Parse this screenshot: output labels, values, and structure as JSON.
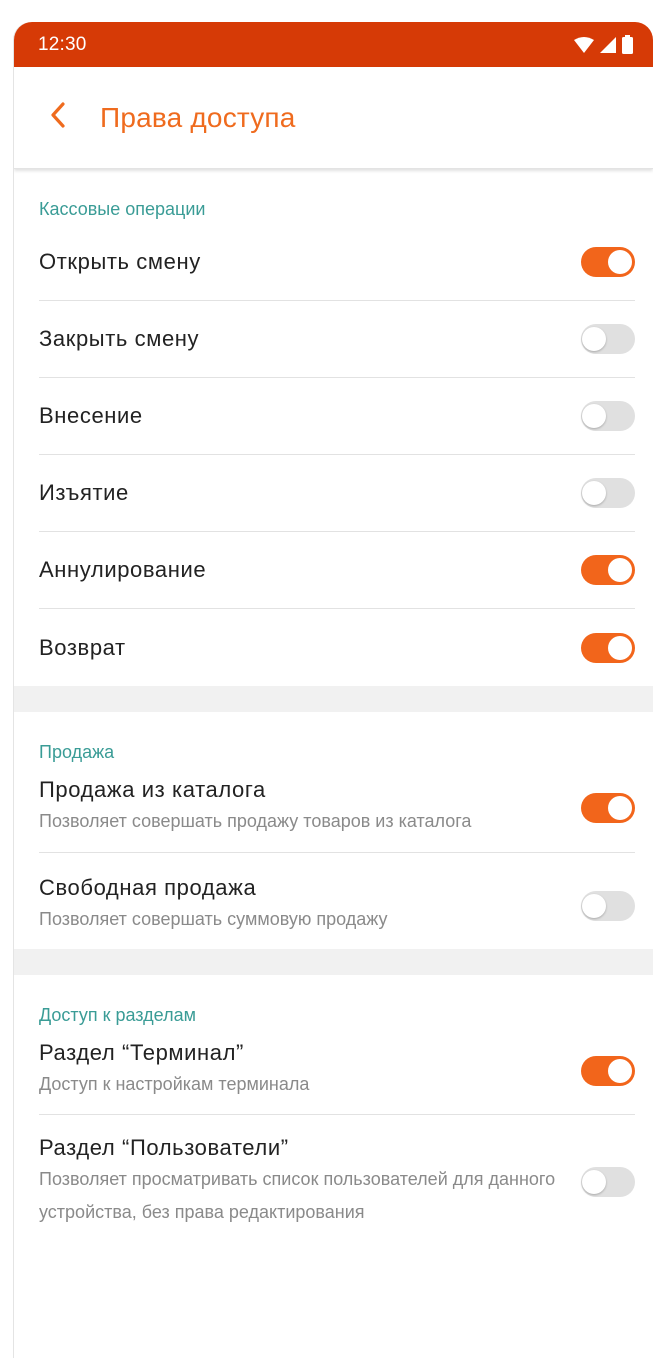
{
  "status_bar": {
    "time": "12:30",
    "icons": [
      "wifi-icon",
      "signal-icon",
      "battery-icon"
    ]
  },
  "header": {
    "title": "Права доступа",
    "back_icon": "chevron-left-icon"
  },
  "colors": {
    "status_bar": "#d63a06",
    "accent": "#f2651b",
    "section_header": "#3a9c96",
    "toggle_off": "#e0e0e0"
  },
  "sections": [
    {
      "title": "Кассовые операции",
      "items": [
        {
          "label": "Открыть смену",
          "enabled": true
        },
        {
          "label": "Закрыть смену",
          "enabled": false
        },
        {
          "label": "Внесение",
          "enabled": false
        },
        {
          "label": "Изъятие",
          "enabled": false
        },
        {
          "label": "Аннулирование",
          "enabled": true
        },
        {
          "label": "Возврат",
          "enabled": true
        }
      ]
    },
    {
      "title": "Продажа",
      "items": [
        {
          "label": "Продажа из каталога",
          "description": "Позволяет совершать продажу товаров из каталога",
          "enabled": true
        },
        {
          "label": "Свободная продажа",
          "description": "Позволяет совершать суммовую продажу",
          "enabled": false
        }
      ]
    },
    {
      "title": "Доступ к разделам",
      "items": [
        {
          "label": "Раздел “Терминал”",
          "description": "Доступ к настройкам терминала",
          "enabled": true
        },
        {
          "label": "Раздел “Пользователи”",
          "description": "Позволяет просматривать список пользователей для данного устройства, без права редактирования",
          "enabled": false
        }
      ]
    }
  ]
}
